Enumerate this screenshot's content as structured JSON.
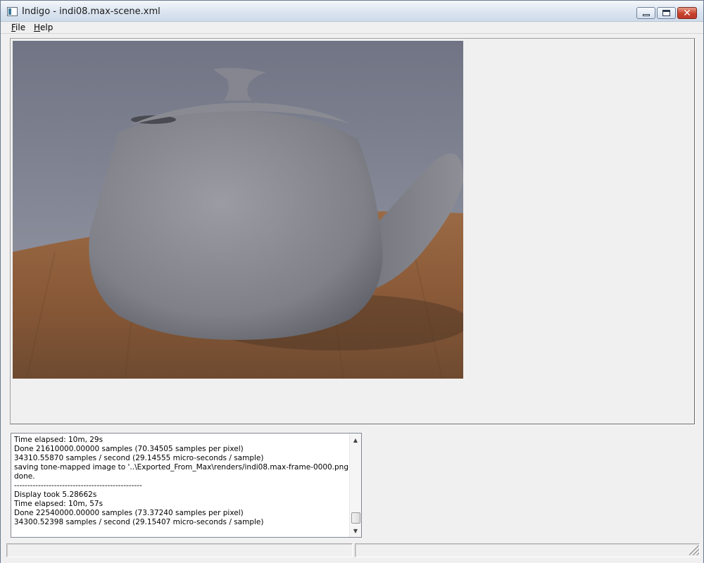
{
  "window": {
    "title": "Indigo - indi08.max-scene.xml",
    "close_glyph": "✕",
    "icons": {
      "app": "app-icon",
      "minimize": "minimize-icon",
      "maximize": "maximize-icon",
      "close": "close-icon"
    }
  },
  "menu": {
    "file": {
      "accel": "F",
      "rest": "ile"
    },
    "help": {
      "accel": "H",
      "rest": "elp"
    }
  },
  "render": {
    "image_description_icon": "render-image"
  },
  "log": {
    "lines": [
      "Time elapsed: 10m, 29s",
      "Done 21610000.00000 samples (70.34505 samples per pixel)",
      "34310.55870 samples / second (29.14555 micro-seconds / sample)",
      "saving tone-mapped image to '..\\Exported_From_Max\\renders/indi08.max-frame-0000.png'",
      "done.",
      "------------------------------------------------",
      "Display took 5.28662s",
      "Time elapsed: 10m, 57s",
      "Done 22540000.00000 samples (73.37240 samples per pixel)",
      "34300.52398 samples / second (29.15407 micro-seconds / sample)"
    ],
    "scroll_up": "▲",
    "scroll_down": "▼"
  },
  "status": {
    "pane1": "",
    "pane2": ""
  }
}
